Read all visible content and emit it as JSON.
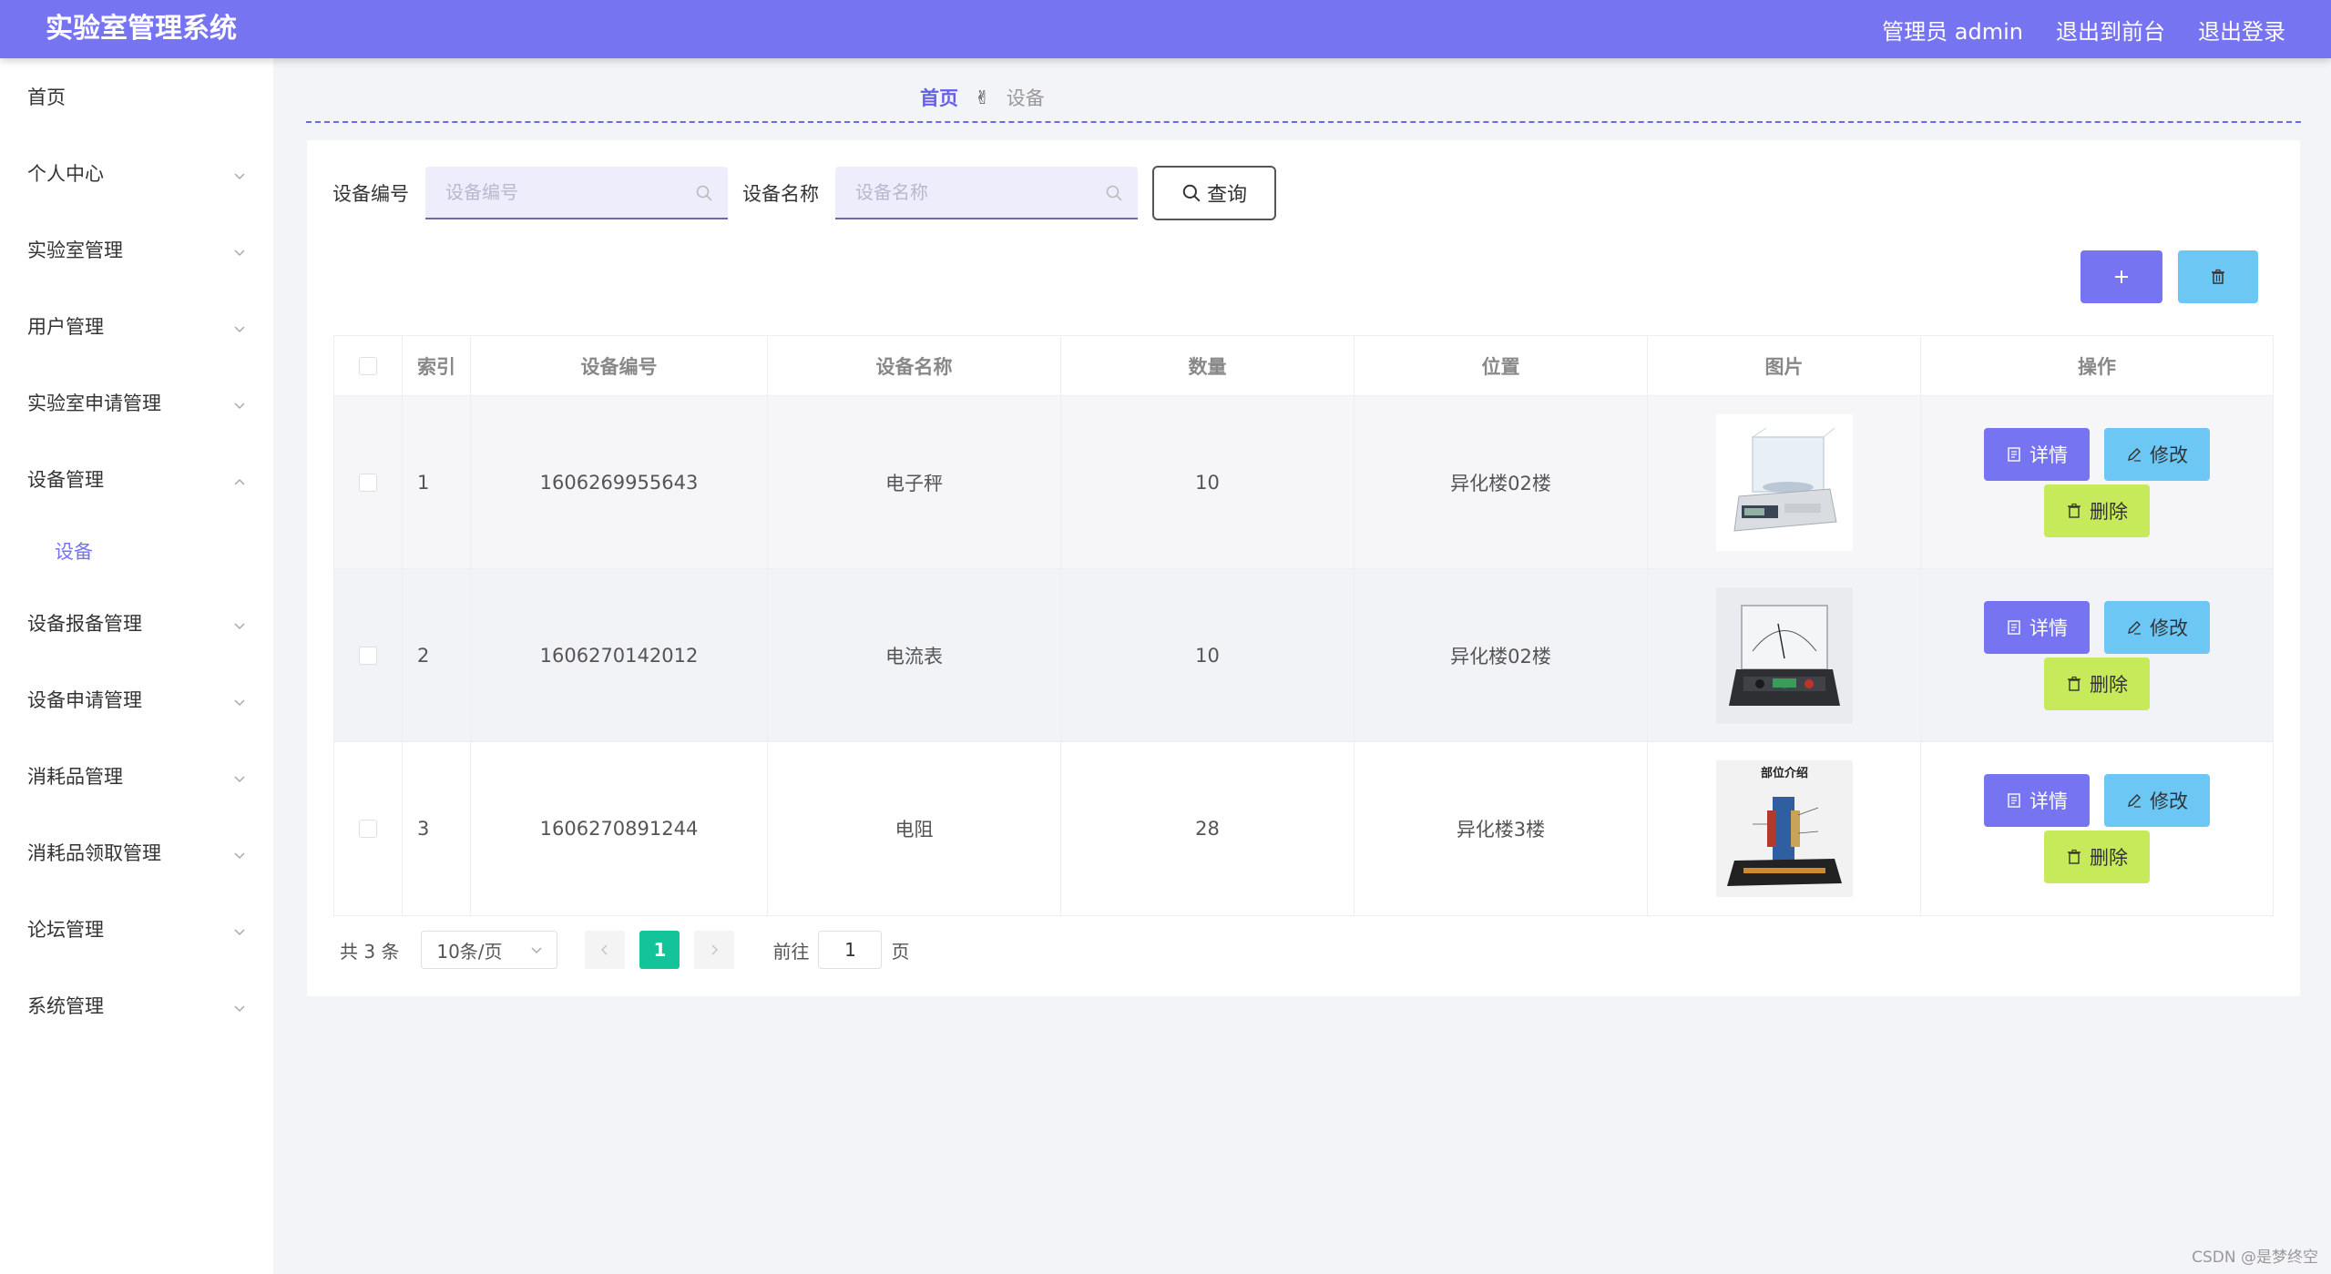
{
  "header": {
    "title": "实验室管理系统",
    "user_label": "管理员 admin",
    "to_frontend": "退出到前台",
    "logout": "退出登录"
  },
  "sidebar": {
    "items": [
      {
        "label": "首页"
      },
      {
        "label": "个人中心"
      },
      {
        "label": "实验室管理"
      },
      {
        "label": "用户管理"
      },
      {
        "label": "实验室申请管理"
      },
      {
        "label": "设备管理"
      },
      {
        "label": "设备"
      },
      {
        "label": "设备报备管理"
      },
      {
        "label": "设备申请管理"
      },
      {
        "label": "消耗品管理"
      },
      {
        "label": "消耗品领取管理"
      },
      {
        "label": "论坛管理"
      },
      {
        "label": "系统管理"
      }
    ]
  },
  "breadcrumb": {
    "home": "首页",
    "separator": "✌",
    "current": "设备"
  },
  "search": {
    "code_label": "设备编号",
    "code_placeholder": "设备编号",
    "name_label": "设备名称",
    "name_placeholder": "设备名称",
    "query_label": "查询"
  },
  "table": {
    "headers": [
      "索引",
      "设备编号",
      "设备名称",
      "数量",
      "位置",
      "图片",
      "操作"
    ],
    "rows": [
      {
        "index": "1",
        "code": "1606269955643",
        "name": "电子秤",
        "qty": "10",
        "location": "异化楼02楼"
      },
      {
        "index": "2",
        "code": "1606270142012",
        "name": "电流表",
        "qty": "10",
        "location": "异化楼02楼"
      },
      {
        "index": "3",
        "code": "1606270891244",
        "name": "电阻",
        "qty": "28",
        "location": "异化楼3楼"
      }
    ],
    "image_caption_row3": "部位介绍",
    "ops": {
      "detail": "详情",
      "edit": "修改",
      "delete": "删除"
    }
  },
  "pagination": {
    "total": "共 3 条",
    "page_size": "10条/页",
    "current_page": "1",
    "goto_prefix": "前往",
    "goto_value": "1",
    "goto_suffix": "页"
  },
  "watermark": "CSDN @是梦终空",
  "colors": {
    "primary": "#7774f2",
    "info": "#6cc7f5",
    "danger_lime": "#c6ea59",
    "pager_active": "#13c39a"
  }
}
